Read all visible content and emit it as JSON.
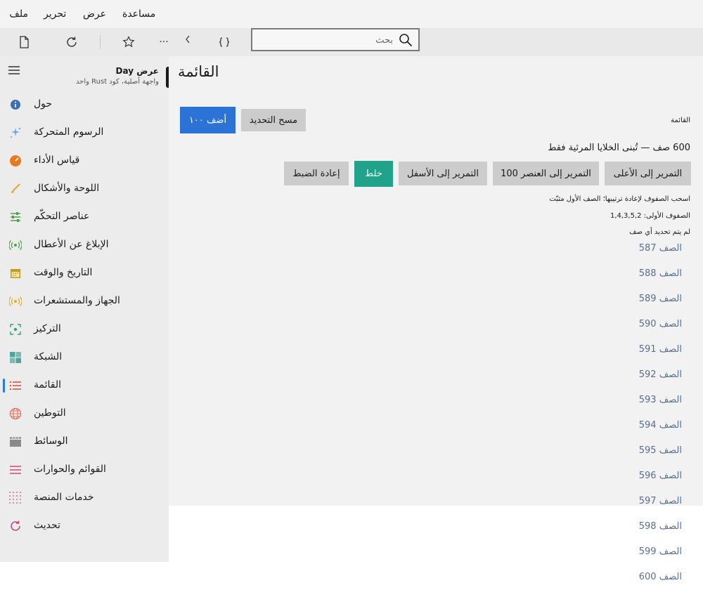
{
  "menu": [
    "ملف",
    "تحرير",
    "عرض",
    "مساعدة"
  ],
  "toolbar": {
    "icons": [
      "new-file-icon",
      "refresh-icon",
      "star-icon",
      "more-icon",
      "chevron-left-icon",
      "code-braces-icon"
    ],
    "more_label": "···",
    "search_placeholder": "بحث"
  },
  "sidebar": {
    "app_title": "عرض Day",
    "app_subtitle": "واجهة أصلية، كود Rust واحد",
    "items": [
      {
        "label": "حول",
        "icon": "info-icon",
        "color": "#3d6fb6"
      },
      {
        "label": "الرسوم المتحركة",
        "icon": "sparkles-icon",
        "color": "#6aa8e8"
      },
      {
        "label": "قياس الأداء",
        "icon": "gauge-icon",
        "color": "#e8791f"
      },
      {
        "label": "اللوحة والأشكال",
        "icon": "brush-icon",
        "color": "#e8a73a"
      },
      {
        "label": "عناصر التحكّم",
        "icon": "sliders-icon",
        "color": "#4aa34a"
      },
      {
        "label": "الإبلاغ عن الأعطال",
        "icon": "broadcast-icon",
        "color": "#4aa34a"
      },
      {
        "label": "التاريخ والوقت",
        "icon": "calendar-icon",
        "color": "#c79a1a"
      },
      {
        "label": "الجهاز والمستشعرات",
        "icon": "sensor-icon",
        "color": "#e0b020"
      },
      {
        "label": "التركيز",
        "icon": "focus-icon",
        "color": "#2ea37e"
      },
      {
        "label": "الشبكة",
        "icon": "grid-icon",
        "color": "#4aa89a"
      },
      {
        "label": "القائمة",
        "icon": "list-icon",
        "color": "#d9463a",
        "active": true
      },
      {
        "label": "التوطين",
        "icon": "globe-icon",
        "color": "#e07060"
      },
      {
        "label": "الوسائط",
        "icon": "clapper-icon",
        "color": "#8a8a8a"
      },
      {
        "label": "القوائم والحوارات",
        "icon": "menu-lines-icon",
        "color": "#d94a6a"
      },
      {
        "label": "خدمات المنصة",
        "icon": "dots-grid-icon",
        "color": "#e07080"
      },
      {
        "label": "تحديث",
        "icon": "refresh-circle-icon",
        "color": "#c0407a"
      }
    ]
  },
  "main": {
    "title": "القائمة",
    "section_label": "القائمة",
    "buttons": {
      "add": "أضف ١٠٠",
      "clear": "مسح التحديد",
      "scroll_top": "التمرير إلى الأعلى",
      "scroll_to_100": "التمرير إلى العنصر 100",
      "scroll_bottom": "التمرير إلى الأسفل",
      "shuffle": "خلط",
      "reset": "إعادة الضبط"
    },
    "count_info": "600 صف — تُبنى الخلايا المرئية فقط",
    "drag_hint": "اسحب الصفوف لإعادة ترتيبها؛ الصف الأول مثبّت",
    "first_rows": "الصفوف الأولى: 1,4,3,5,2",
    "selection": "لم يتم تحديد أي صف",
    "rows": [
      "الصف 587",
      "الصف 588",
      "الصف 589",
      "الصف 590",
      "الصف 591",
      "الصف 592",
      "الصف 593",
      "الصف 594",
      "الصف 595",
      "الصف 596",
      "الصف 597",
      "الصف 598",
      "الصف 599",
      "الصف 600"
    ]
  },
  "colors": {
    "accent": "#2b73d6",
    "teal": "#21a28a",
    "row_text": "#5a6e8c"
  }
}
